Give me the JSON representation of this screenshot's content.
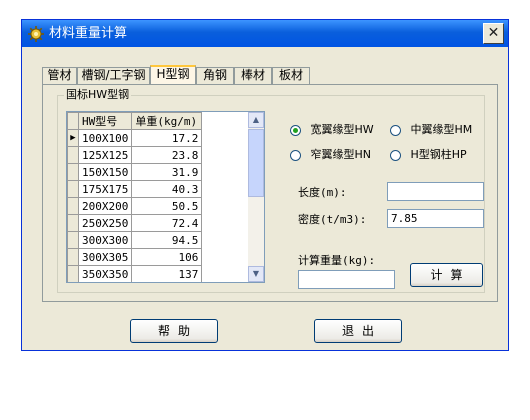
{
  "window": {
    "title": "材料重量计算",
    "close_glyph": "✕",
    "icon": "gear-icon"
  },
  "tabs": [
    "管材",
    "槽钢/工字钢",
    "H型钢",
    "角钢",
    "棒材",
    "板材"
  ],
  "active_tab": "H型钢",
  "group": {
    "label": "国标HW型钢"
  },
  "table": {
    "headers": [
      "HW型号",
      "单重(kg/m)"
    ],
    "rows": [
      [
        "100X100",
        "17.2"
      ],
      [
        "125X125",
        "23.8"
      ],
      [
        "150X150",
        "31.9"
      ],
      [
        "175X175",
        "40.3"
      ],
      [
        "200X200",
        "50.5"
      ],
      [
        "250X250",
        "72.4"
      ],
      [
        "300X300",
        "94.5"
      ],
      [
        "300X305",
        "106"
      ],
      [
        "350X350",
        "137"
      ]
    ],
    "selected_row": 0,
    "row_indicator": "▶"
  },
  "radios": [
    {
      "label": "宽翼缘型HW",
      "checked": true
    },
    {
      "label": "中翼缘型HM",
      "checked": false
    },
    {
      "label": "窄翼缘型HN",
      "checked": false
    },
    {
      "label": "H型钢柱HP",
      "checked": false
    }
  ],
  "fields": {
    "length_label": "长度(m):",
    "length_value": "",
    "density_label": "密度(t/m3):",
    "density_value": "7.85",
    "result_label": "计算重量(kg):",
    "result_value": ""
  },
  "buttons": {
    "calc": "计算",
    "help": "帮助",
    "exit": "退出"
  },
  "scroll": {
    "up": "▲",
    "down": "▼"
  }
}
